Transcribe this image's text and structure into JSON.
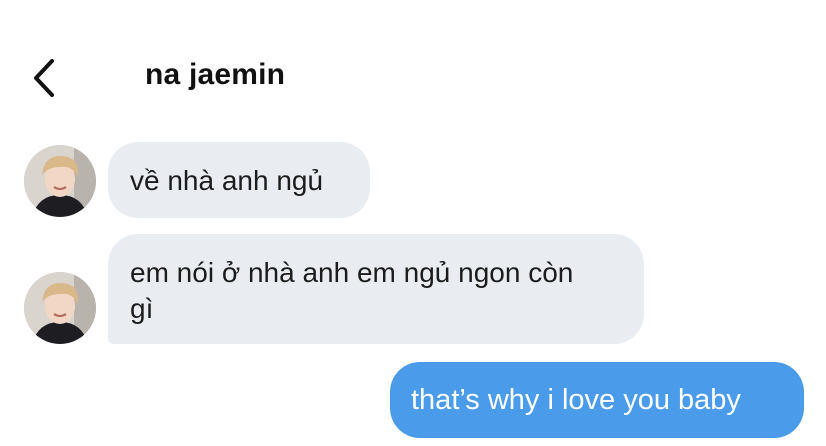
{
  "header": {
    "title": "na jaemin",
    "back_icon": "chevron-left-icon"
  },
  "messages": [
    {
      "sender": "them",
      "text": "về nhà anh ngủ",
      "show_avatar": true
    },
    {
      "sender": "them",
      "text": "em nói ở nhà anh em ngủ ngon còn gì",
      "show_avatar": true
    },
    {
      "sender": "me",
      "text": "that’s why i love you baby",
      "show_avatar": false
    }
  ],
  "colors": {
    "incoming_bubble": "#e9edf2",
    "outgoing_bubble": "#4a9bea",
    "outgoing_text": "#ffffff",
    "text": "#1c1c1c"
  }
}
